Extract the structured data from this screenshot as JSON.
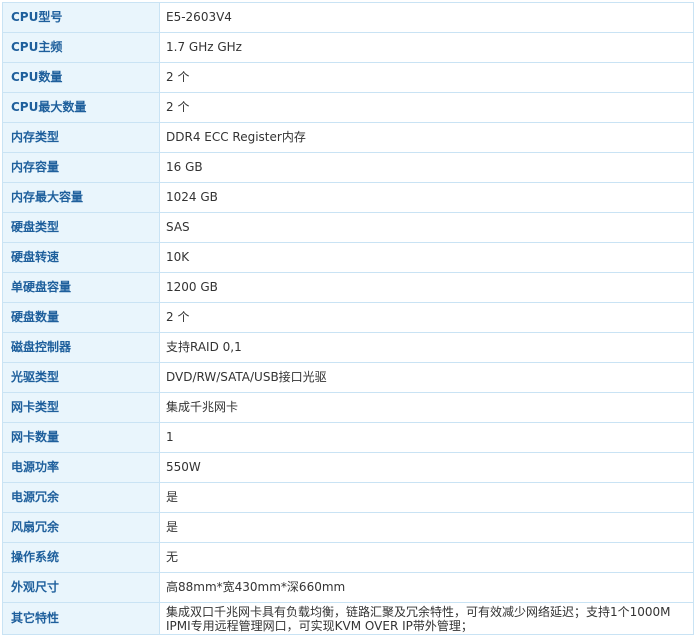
{
  "specs": [
    {
      "label": "CPU型号",
      "value": "E5-2603V4"
    },
    {
      "label": "CPU主频",
      "value": "1.7 GHz  GHz"
    },
    {
      "label": "CPU数量",
      "value": "2  个"
    },
    {
      "label": "CPU最大数量",
      "value": "2  个"
    },
    {
      "label": "内存类型",
      "value": "DDR4 ECC Register内存"
    },
    {
      "label": "内存容量",
      "value": "16  GB"
    },
    {
      "label": "内存最大容量",
      "value": "1024  GB"
    },
    {
      "label": "硬盘类型",
      "value": "SAS"
    },
    {
      "label": "硬盘转速",
      "value": "10K"
    },
    {
      "label": "单硬盘容量",
      "value": "1200  GB"
    },
    {
      "label": "硬盘数量",
      "value": "2  个"
    },
    {
      "label": "磁盘控制器",
      "value": "支持RAID 0,1"
    },
    {
      "label": "光驱类型",
      "value": "DVD/RW/SATA/USB接口光驱"
    },
    {
      "label": "网卡类型",
      "value": "集成千兆网卡"
    },
    {
      "label": "网卡数量",
      "value": "1"
    },
    {
      "label": "电源功率",
      "value": "550W"
    },
    {
      "label": "电源冗余",
      "value": "是"
    },
    {
      "label": "风扇冗余",
      "value": "是"
    },
    {
      "label": "操作系统",
      "value": "无"
    },
    {
      "label": "外观尺寸",
      "value": "高88mm*宽430mm*深660mm"
    },
    {
      "label": "其它特性",
      "value": "集成双口千兆网卡具有负载均衡，链路汇聚及冗余特性，可有效减少网络延迟；支持1个1000M IPMI专用远程管理网口，可实现KVM OVER IP带外管理；"
    }
  ]
}
